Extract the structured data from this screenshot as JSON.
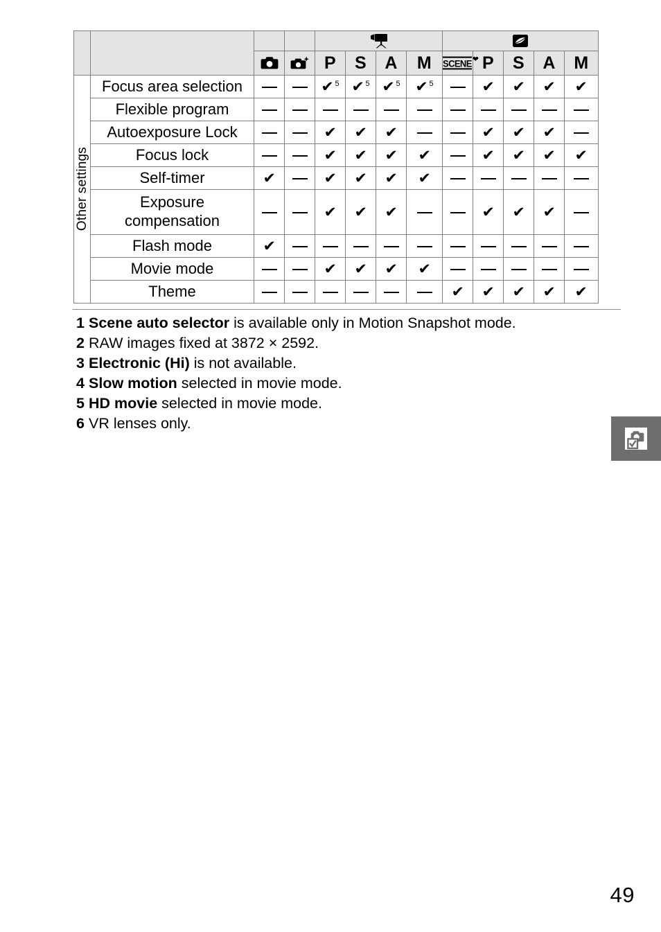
{
  "table": {
    "row_group_label": "Other settings",
    "groups": [
      {
        "label": "",
        "icon": "camera-icon",
        "span": 1
      },
      {
        "label": "",
        "icon": "scene-auto-selector-icon",
        "span": 1
      },
      {
        "label": "",
        "icon": "movie-camera-icon",
        "span": 4
      },
      {
        "label": "",
        "icon": "motion-snapshot-icon",
        "span": 5
      }
    ],
    "columns": [
      {
        "label": "",
        "icon": "camera-icon"
      },
      {
        "label": "",
        "icon": "scene-auto-selector-icon"
      },
      {
        "label": "P",
        "icon": ""
      },
      {
        "label": "S",
        "icon": ""
      },
      {
        "label": "A",
        "icon": ""
      },
      {
        "label": "M",
        "icon": ""
      },
      {
        "label": "SCENE",
        "icon": "scene-heart-icon"
      },
      {
        "label": "P",
        "icon": ""
      },
      {
        "label": "S",
        "icon": ""
      },
      {
        "label": "A",
        "icon": ""
      },
      {
        "label": "M",
        "icon": ""
      }
    ],
    "rows": [
      {
        "label": "Focus area selection",
        "cells": [
          "—",
          "—",
          "✔5",
          "✔5",
          "✔5",
          "✔5",
          "—",
          "✔",
          "✔",
          "✔",
          "✔"
        ]
      },
      {
        "label": "Flexible program",
        "cells": [
          "—",
          "—",
          "—",
          "—",
          "—",
          "—",
          "—",
          "—",
          "—",
          "—",
          "—"
        ]
      },
      {
        "label": "Autoexposure Lock",
        "cells": [
          "—",
          "—",
          "✔",
          "✔",
          "✔",
          "—",
          "—",
          "✔",
          "✔",
          "✔",
          "—"
        ]
      },
      {
        "label": "Focus lock",
        "cells": [
          "—",
          "—",
          "✔",
          "✔",
          "✔",
          "✔",
          "—",
          "✔",
          "✔",
          "✔",
          "✔"
        ]
      },
      {
        "label": "Self-timer",
        "cells": [
          "✔",
          "—",
          "✔",
          "✔",
          "✔",
          "✔",
          "—",
          "—",
          "—",
          "—",
          "—"
        ]
      },
      {
        "label": "Exposure compensation",
        "cells": [
          "—",
          "—",
          "✔",
          "✔",
          "✔",
          "—",
          "—",
          "✔",
          "✔",
          "✔",
          "—"
        ]
      },
      {
        "label": "Flash mode",
        "cells": [
          "✔",
          "—",
          "—",
          "—",
          "—",
          "—",
          "—",
          "—",
          "—",
          "—",
          "—"
        ]
      },
      {
        "label": "Movie mode",
        "cells": [
          "—",
          "—",
          "✔",
          "✔",
          "✔",
          "✔",
          "—",
          "—",
          "—",
          "—",
          "—"
        ]
      },
      {
        "label": "Theme",
        "cells": [
          "—",
          "—",
          "—",
          "—",
          "—",
          "—",
          "✔",
          "✔",
          "✔",
          "✔",
          "✔"
        ]
      }
    ]
  },
  "footnotes": [
    {
      "num": "1",
      "bold": "Scene auto selector",
      "rest": " is available only in Motion Snapshot mode."
    },
    {
      "num": "2",
      "bold": "",
      "rest": "RAW images fixed at 3872 × 2592."
    },
    {
      "num": "3",
      "bold": "Electronic (Hi)",
      "rest": " is not available."
    },
    {
      "num": "4",
      "bold": "Slow motion",
      "rest": " selected in movie mode."
    },
    {
      "num": "5",
      "bold": "HD movie",
      "rest": " selected in movie mode."
    },
    {
      "num": "6",
      "bold": "",
      "rest": "VR lenses only."
    }
  ],
  "side_tab": {
    "icon": "camera-checkbox-icon",
    "color": "#6e6e6e"
  },
  "page_number": "49",
  "colors": {
    "header_bg": "#e4e4e4",
    "border": "#808080",
    "text": "#000000",
    "tab_bg": "#6e6e6e"
  }
}
